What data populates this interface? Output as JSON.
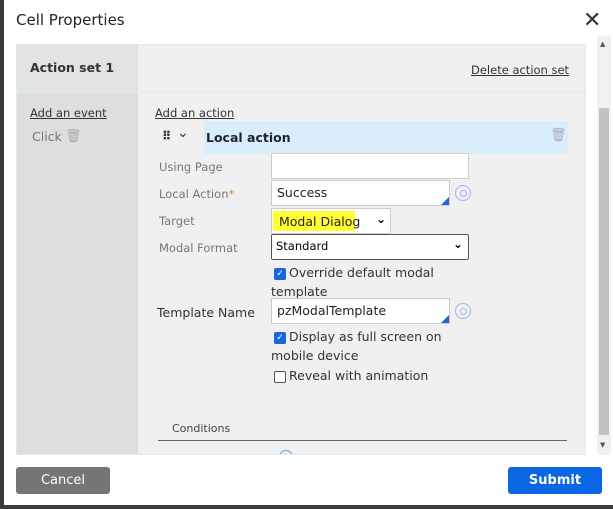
{
  "dialog": {
    "title": "Cell Properties",
    "close_icon": "close-icon"
  },
  "action_set": {
    "title": "Action set 1",
    "delete_label": "Delete action set",
    "add_event": "Add an event",
    "event": "Click",
    "add_action": "Add an action",
    "action_title": "Local action"
  },
  "form": {
    "using_page_label": "Using Page",
    "using_page_value": "",
    "local_action_label": "Local Action",
    "required_mark": "*",
    "local_action_value": "Success",
    "target_label": "Target",
    "target_value": "Modal Dialog",
    "modal_format_label": "Modal Format",
    "modal_format_value": "Standard",
    "override_label": "Override default modal template",
    "override_checked": true,
    "template_name_label": "Template Name",
    "template_name_value": "pzModalTemplate",
    "fullscreen_label": "Display as full screen on mobile device",
    "fullscreen_checked": true,
    "reveal_label": "Reveal with animation",
    "reveal_checked": false,
    "conditions_label": "Conditions"
  },
  "footer": {
    "cancel": "Cancel",
    "submit": "Submit"
  },
  "colors": {
    "accent": "#0b66e4",
    "highlight": "#ffff33",
    "action_header": "#d9eefa",
    "cancel": "#757575"
  }
}
